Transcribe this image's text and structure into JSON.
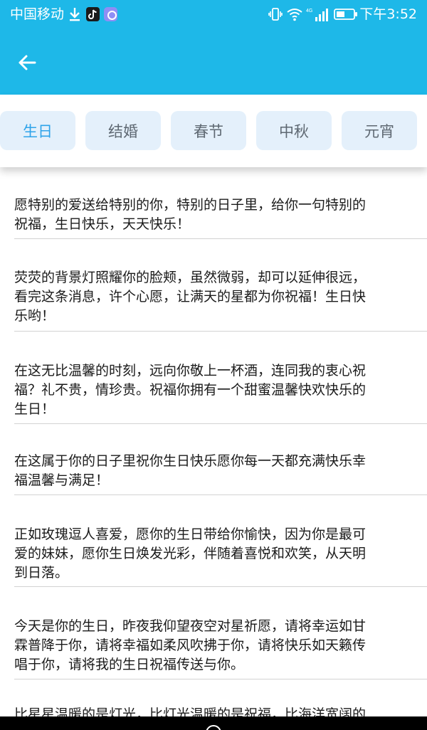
{
  "status_bar": {
    "carrier": "中国移动",
    "network_label": "4G",
    "time": "下午3:52",
    "icons": [
      "download-icon",
      "tiktok-icon",
      "app-icon",
      "vibrate-icon",
      "wifi-icon",
      "signal-icon",
      "battery-icon"
    ]
  },
  "header": {
    "back_icon": "arrow-left-icon",
    "bar_color": "#1eb8e8"
  },
  "tabs": [
    {
      "label": "生日",
      "active": true
    },
    {
      "label": "结婚",
      "active": false
    },
    {
      "label": "春节",
      "active": false
    },
    {
      "label": "中秋",
      "active": false
    },
    {
      "label": "元宵",
      "active": false
    }
  ],
  "colors": {
    "accent": "#2ea3ea",
    "tab_background": "#e4f0fb",
    "text": "#1a1a1a",
    "divider": "#d2d2d2"
  },
  "messages": [
    {
      "lines": [
        "愿特别的爱送给特别的你，特别的日子里，给你一句特别的",
        "祝福，生日快乐，天天快乐！"
      ]
    },
    {
      "lines": [
        "荧荧的背景灯照耀你的脸颊，虽然微弱，却可以延伸很远，",
        "看完这条消息，许个心愿，让满天的星都为你祝福！生日快",
        "乐哟！"
      ]
    },
    {
      "lines": [
        "在这无比温馨的时刻，远向你敬上一杯酒，连同我的衷心祝",
        "福？礼不贵，情珍贵。祝福你拥有一个甜蜜温馨快欢快乐的",
        "生日！"
      ]
    },
    {
      "lines": [
        "在这属于你的日子里祝你生日快乐愿你每一天都充满快乐幸",
        "福温馨与满足！"
      ]
    },
    {
      "lines": [
        "正如玫瑰逗人喜爱，愿你的生日带给你愉快，因为你是最可",
        "爱的妹妹，愿你生日焕发光彩，伴随着喜悦和欢笑，从天明",
        "到日落。"
      ]
    },
    {
      "lines": [
        "今天是你的生日，昨夜我仰望夜空对星祈愿，请将幸运如甘",
        "霖普降于你，请将幸福如柔风吹拂于你，请将快乐如天籁传",
        "唱于你，请将我的生日祝福传送与你。"
      ]
    },
    {
      "lines": [
        "比星星温暖的是灯光，比灯光温暖的是祝福，比海洋宽阔的"
      ]
    }
  ],
  "nav_bar": {
    "home_icon": "circle-home-icon"
  }
}
